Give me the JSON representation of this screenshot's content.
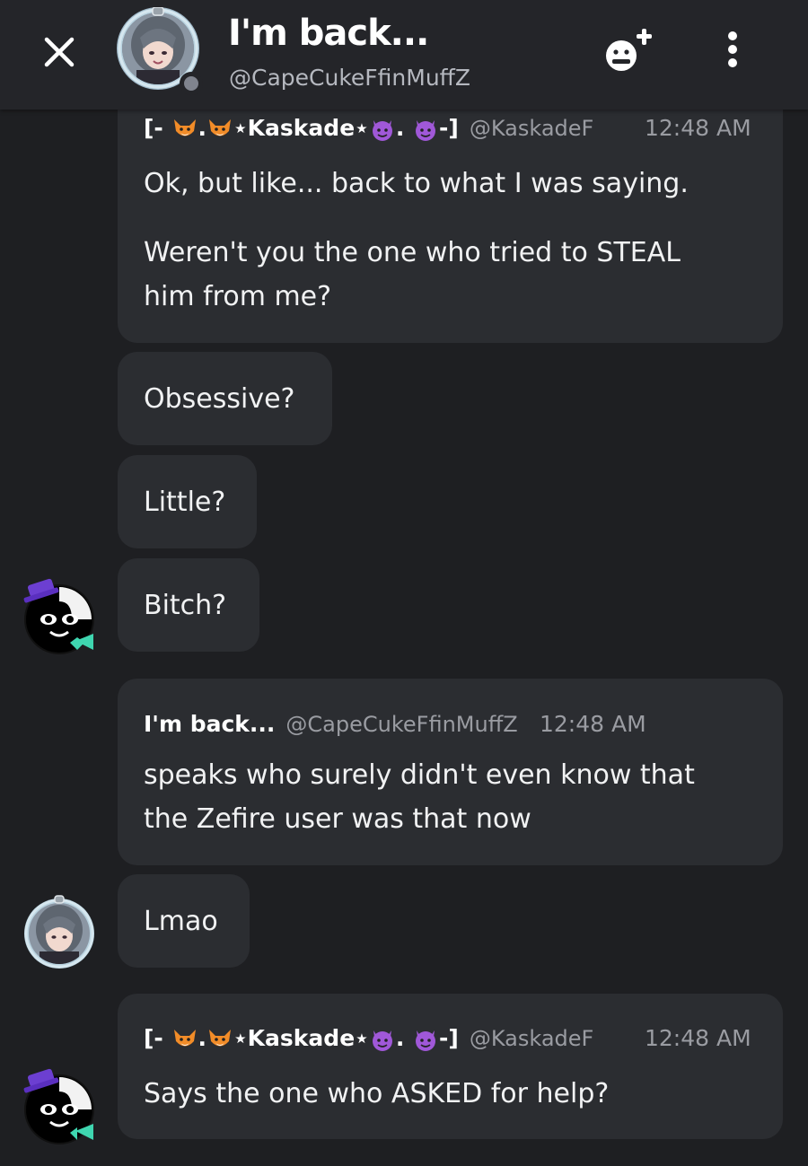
{
  "header": {
    "name": "I'm back...",
    "handle": "@CapeCukeFfinMuffZ"
  },
  "messages": [
    {
      "author_prefix": "[-",
      "author_mid": ".",
      "author_name": "⋆Kaskade⋆",
      "author_dot": ".",
      "author_suffix": "-]",
      "handle": "@KaskadeF",
      "time": "12:48 AM",
      "lines": [
        "Ok, but like... back to what I was saying."
      ],
      "lines2": [
        "Weren't you the one who tried to STEAL",
        "him from me?"
      ]
    },
    {
      "lines": [
        "Obsessive?"
      ]
    },
    {
      "lines": [
        "Little?"
      ]
    },
    {
      "lines": [
        "Bitch?"
      ]
    },
    {
      "author_name": "I'm back...",
      "handle": "@CapeCukeFfinMuffZ",
      "time": "12:48 AM",
      "lines": [
        "speaks who surely didn't even know that",
        "the Zefire user was that now"
      ]
    },
    {
      "lines": [
        "Lmao"
      ]
    },
    {
      "author_prefix": "[-",
      "author_mid": ".",
      "author_name": "⋆Kaskade⋆",
      "author_dot": ".",
      "author_suffix": "-]",
      "handle": "@KaskadeF",
      "time": "12:48 AM",
      "lines": [
        "Says the one who ASKED for help?"
      ]
    }
  ],
  "colors": {
    "background": "#1e1f22",
    "header": "#242529",
    "bubble": "#2b2d31",
    "muted_text": "#9a9ca2",
    "status_offline": "#80848e"
  },
  "icons": [
    "close-icon",
    "add-friend-icon",
    "more-vertical-icon",
    "fox-emoji",
    "devil-emoji"
  ]
}
